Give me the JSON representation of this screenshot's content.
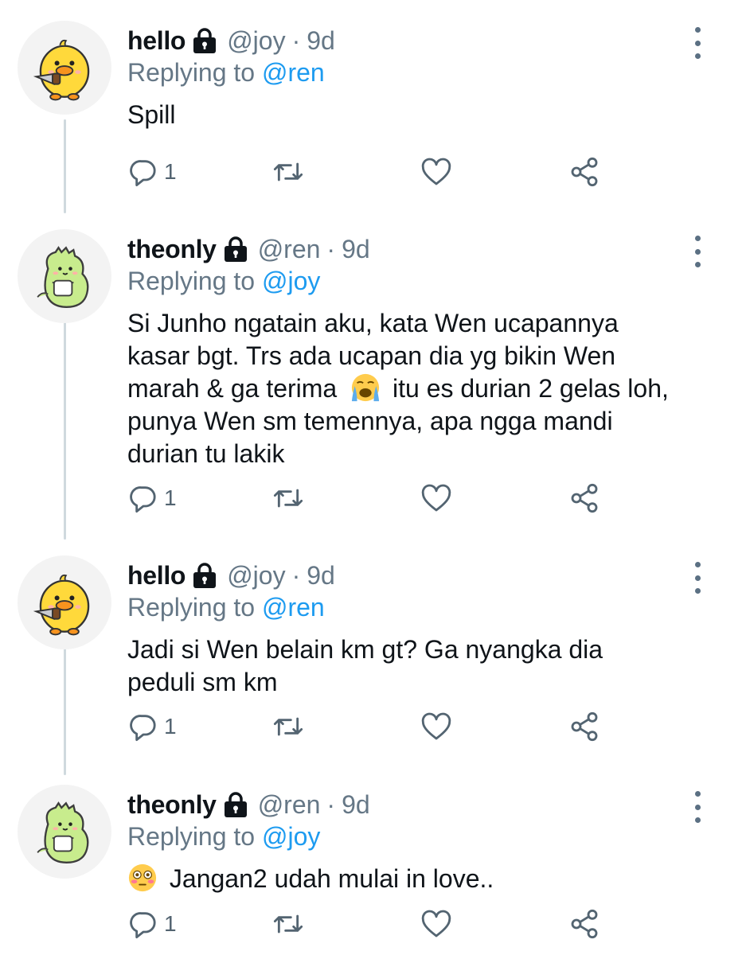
{
  "tweets": [
    {
      "display_name": "hello",
      "handle": "@joy",
      "time": "9d",
      "replying_prefix": "Replying to",
      "replying_to": "@ren",
      "text": "Spill",
      "emoji_prefix": "",
      "reply_count": "1",
      "avatar": "duck-avatar"
    },
    {
      "display_name": "theonly",
      "handle": "@ren",
      "time": "9d",
      "replying_prefix": "Replying to",
      "replying_to": "@joy",
      "text_lines": [
        "Si Junho ngatain aku, kata Wen ucapannya",
        "kasar bgt. Trs ada ucapan dia yg bikin Wen",
        "marah & ga terima",
        "itu es durian 2 gelas loh,",
        "punya Wen sm temennya, apa ngga mandi",
        "durian tu lakik"
      ],
      "inline_emoji": "loudly-crying-face",
      "reply_count": "1",
      "avatar": "dino-avatar"
    },
    {
      "display_name": "hello",
      "handle": "@joy",
      "time": "9d",
      "replying_prefix": "Replying to",
      "replying_to": "@ren",
      "text_lines": [
        "Jadi si Wen belain km gt? Ga nyangka dia",
        "peduli sm km"
      ],
      "reply_count": "1",
      "avatar": "duck-avatar"
    },
    {
      "display_name": "theonly",
      "handle": "@ren",
      "time": "9d",
      "replying_prefix": "Replying to",
      "replying_to": "@joy",
      "text": "Jangan2 udah mulai in love..",
      "emoji_prefix": "flushed-face",
      "reply_count": "1",
      "avatar": "dino-avatar"
    }
  ],
  "separator": "·",
  "icons": {
    "lock": "lock-icon",
    "reply": "reply-icon",
    "retweet": "retweet-icon",
    "like": "heart-icon",
    "share": "share-icon",
    "more": "more-vertical-icon"
  },
  "colors": {
    "mention": "#1d9bf0",
    "muted": "#657786",
    "icon": "#536471"
  }
}
